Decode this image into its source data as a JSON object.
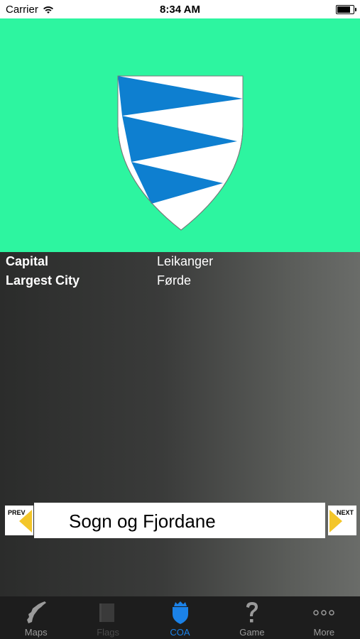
{
  "status_bar": {
    "carrier": "Carrier",
    "time": "8:34 AM",
    "battery_level": 0.9
  },
  "coa": {
    "background_color": "#2df5a0",
    "blue": "#0e7fd0",
    "white": "#ffffff"
  },
  "info": {
    "rows": [
      {
        "label": "Capital",
        "value": "Leikanger"
      },
      {
        "label": "Largest City",
        "value": "Førde"
      }
    ]
  },
  "navigation": {
    "prev_label": "PREV",
    "next_label": "NEXT",
    "region_name": "Sogn og Fjordane",
    "arrow_color": "#f3c62a"
  },
  "tabs": [
    {
      "label": "Maps",
      "icon": "norway-map-icon",
      "state": "normal"
    },
    {
      "label": "Flags",
      "icon": "flag-icon",
      "state": "disabled"
    },
    {
      "label": "COA",
      "icon": "coat-of-arms-icon",
      "state": "active"
    },
    {
      "label": "Game",
      "icon": "question-mark-icon",
      "state": "normal"
    },
    {
      "label": "More",
      "icon": "more-dots-icon",
      "state": "normal"
    }
  ],
  "tab_colors": {
    "active": "#1b82e8",
    "normal": "#9a9a9a",
    "disabled": "#4a4a4a"
  }
}
